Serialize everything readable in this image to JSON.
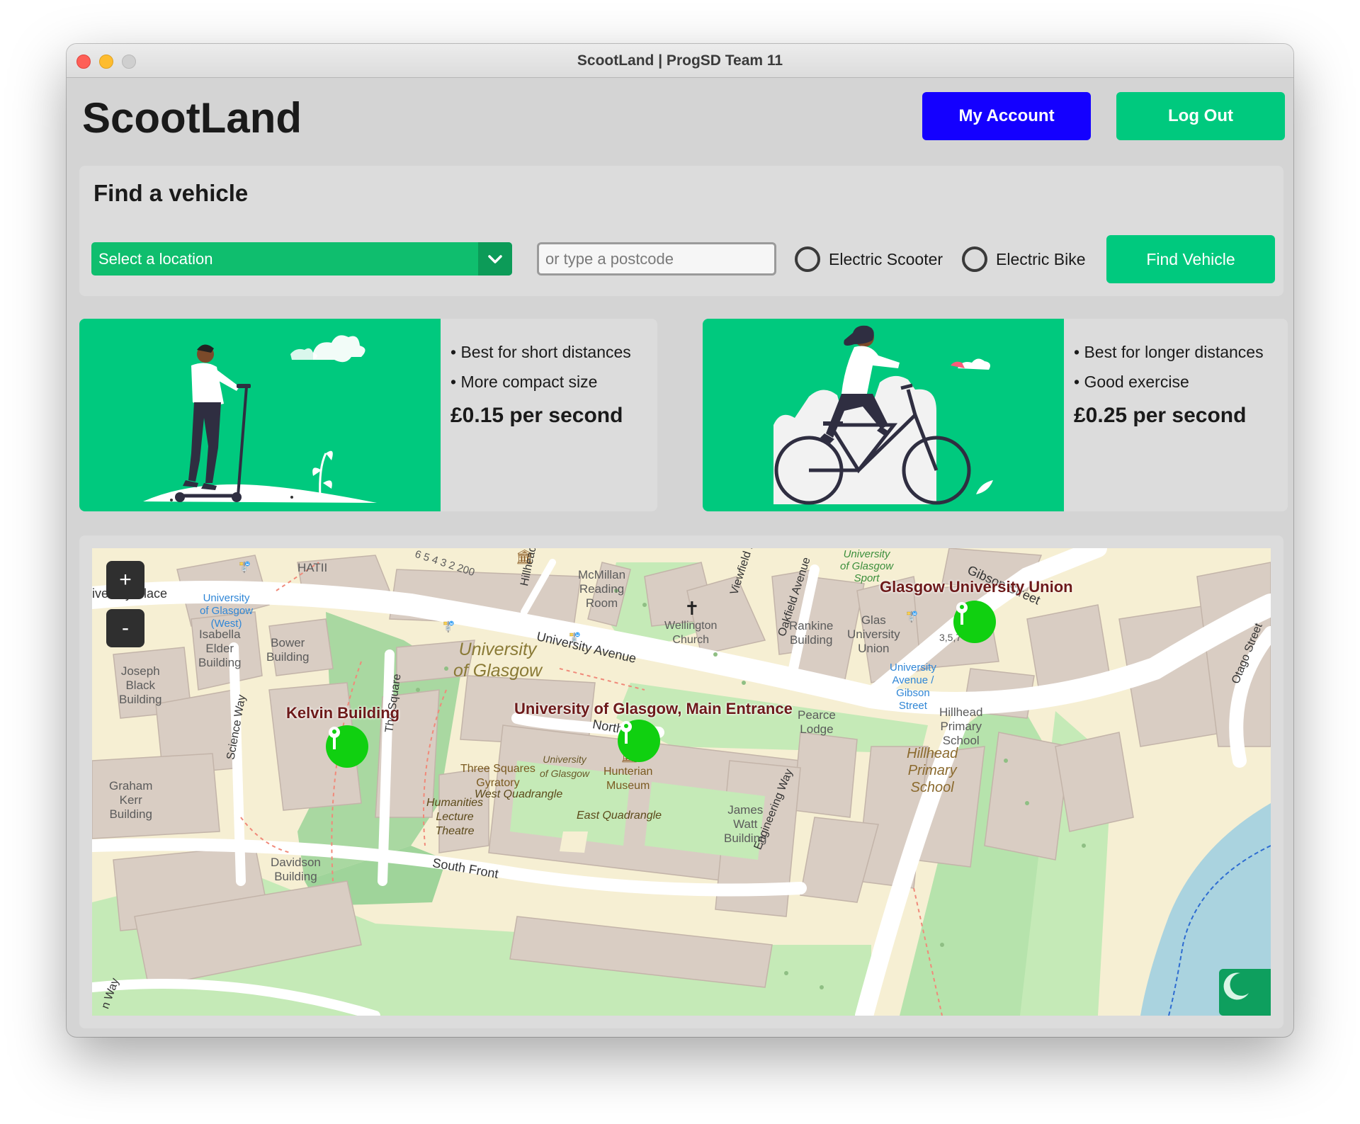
{
  "window": {
    "title": "ScootLand | ProgSD Team 11"
  },
  "header": {
    "app_title": "ScootLand",
    "my_account_label": "My Account",
    "logout_label": "Log Out"
  },
  "find": {
    "title": "Find a vehicle",
    "select_label": "Select a location",
    "postcode_placeholder": "or type a postcode",
    "scooter_label": "Electric Scooter",
    "bike_label": "Electric Bike",
    "find_button_label": "Find Vehicle"
  },
  "cards": {
    "scooter": {
      "bullet1": "• Best for short distances",
      "bullet2": "• More compact size",
      "price": "£0.15 per second"
    },
    "bike": {
      "bullet1": "• Best for longer distances",
      "bullet2": "• Good exercise",
      "price": "£0.25 per second"
    }
  },
  "map": {
    "zoom_in": "+",
    "zoom_out": "-",
    "markers": {
      "kelvin": "Kelvin Building",
      "main_entrance": "University of Glasgow, Main Entrance",
      "union": "Glasgow University Union"
    },
    "labels": {
      "hatii": "HATII",
      "university_place": "iversity Place",
      "uog_west": "University\nof Glasgow\n(West)",
      "isabella": "Isabella\nElder\nBuilding",
      "bower": "Bower\nBuilding",
      "joseph": "Joseph\nBlack\nBuilding",
      "graham": "Graham\nKerr\nBuilding",
      "davidson": "Davidson\nBuilding",
      "mcmillan": "McMillan\nReading\nRoom",
      "wellington": "Wellington\nChurch",
      "rankine": "Rankine\nBuilding",
      "union_bldg": "Glas\nUniversity\nUnion",
      "uog_sport": "University\nof Glasgow\nSport",
      "uog_big": "University\nof Glasgow",
      "three_squares": "Three Squares\nGyratory",
      "west_quad": "West Quadrangle",
      "uog_small": "University\nof Glasgow",
      "hunterian": "Hunterian\nMuseum",
      "east_quad": "East Quadrangle",
      "humanities": "Humanities\nLecture\nTheatre",
      "pearce": "Pearce\nLodge",
      "james_watt": "James\nWatt\nBuilding",
      "hillhead_school": "Hillhead\nPrimary\nSchool",
      "hillhead_school_ital": "Hillhead\nPrimary\nSchool",
      "uog_gibson": "University\nAvenue /\nGibson\nStreet",
      "street_univ_ave": "University Avenue",
      "street_north_front": "North Front",
      "street_south_front": "South Front",
      "street_gibson": "Gibson Street",
      "street_otago": "Otago Street",
      "street_oakfield": "Oakfield Avenue",
      "street_science_way": "Science Way",
      "street_square": "The Square",
      "street_engineering": "Engineering Way",
      "street_hillhead": "Hillhead",
      "street_viewfield": "Viewfield L",
      "street_way": "n Way",
      "house_numbers": "6  5  4  3  2  200",
      "num_357": "3,5,7"
    }
  },
  "colors": {
    "accent_green": "#00c97e",
    "account_blue": "#1400ff",
    "marker_green": "#10d010",
    "marker_label": "#6d1a1a"
  },
  "icons": [
    "dropdown-chevron-icon",
    "key-marker-icon",
    "moon-icon",
    "church-cross-icon",
    "museum-icon",
    "bus-stop-icon"
  ]
}
